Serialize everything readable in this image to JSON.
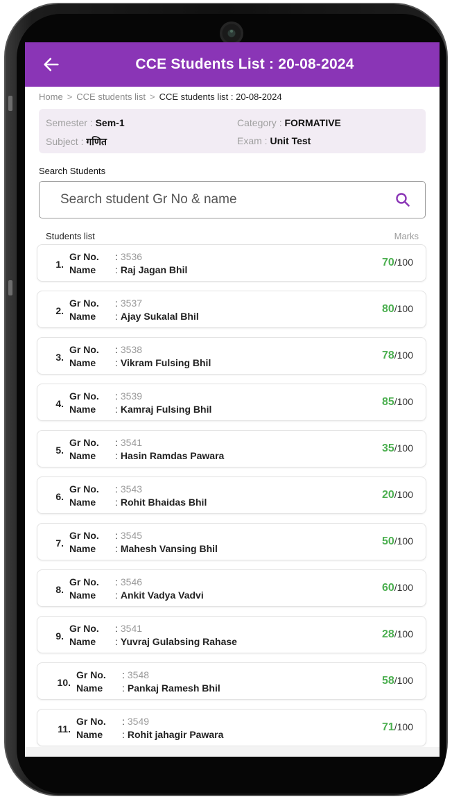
{
  "header": {
    "title": "CCE Students List : 20-08-2024"
  },
  "breadcrumb": {
    "items": [
      "Home",
      "CCE students list",
      "CCE students list : 20-08-2024"
    ],
    "separator": ">"
  },
  "info": {
    "semester_label": "Semester : ",
    "semester_value": "Sem-1",
    "category_label": "Category : ",
    "category_value": "FORMATIVE",
    "subject_label": "Subject : ",
    "subject_value": "गणित",
    "exam_label": "Exam : ",
    "exam_value": "Unit Test"
  },
  "search": {
    "label": "Search Students",
    "placeholder": "Search student Gr No & name",
    "value": ""
  },
  "list": {
    "title": "Students list",
    "marks_header": "Marks",
    "gr_key": "Gr No.",
    "name_key": "Name",
    "colon": ":",
    "total": "/100",
    "students": [
      {
        "index": "1.",
        "gr_no": "3536",
        "name": "Raj Jagan Bhil",
        "marks": "70"
      },
      {
        "index": "2.",
        "gr_no": "3537",
        "name": "Ajay Sukalal Bhil",
        "marks": "80"
      },
      {
        "index": "3.",
        "gr_no": "3538",
        "name": "Vikram Fulsing Bhil",
        "marks": "78"
      },
      {
        "index": "4.",
        "gr_no": "3539",
        "name": "Kamraj Fulsing Bhil",
        "marks": "85"
      },
      {
        "index": "5.",
        "gr_no": "3541",
        "name": "Hasin Ramdas Pawara",
        "marks": "35"
      },
      {
        "index": "6.",
        "gr_no": "3543",
        "name": "Rohit Bhaidas Bhil",
        "marks": "20"
      },
      {
        "index": "7.",
        "gr_no": "3545",
        "name": "Mahesh Vansing Bhil",
        "marks": "50"
      },
      {
        "index": "8.",
        "gr_no": "3546",
        "name": "Ankit Vadya Vadvi",
        "marks": "60"
      },
      {
        "index": "9.",
        "gr_no": "3541",
        "name": "Yuvraj Gulabsing Rahase",
        "marks": "28"
      },
      {
        "index": "10.",
        "gr_no": "3548",
        "name": "Pankaj Ramesh Bhil",
        "marks": "58"
      },
      {
        "index": "11.",
        "gr_no": "3549",
        "name": "Rohit jahagir Pawara",
        "marks": "71"
      }
    ]
  },
  "colors": {
    "app_bar": "#8a35b6",
    "info_card": "#f2ecf4",
    "marks_score": "#4caf50"
  },
  "icons": {
    "back": "arrow-left",
    "search": "magnifier"
  }
}
